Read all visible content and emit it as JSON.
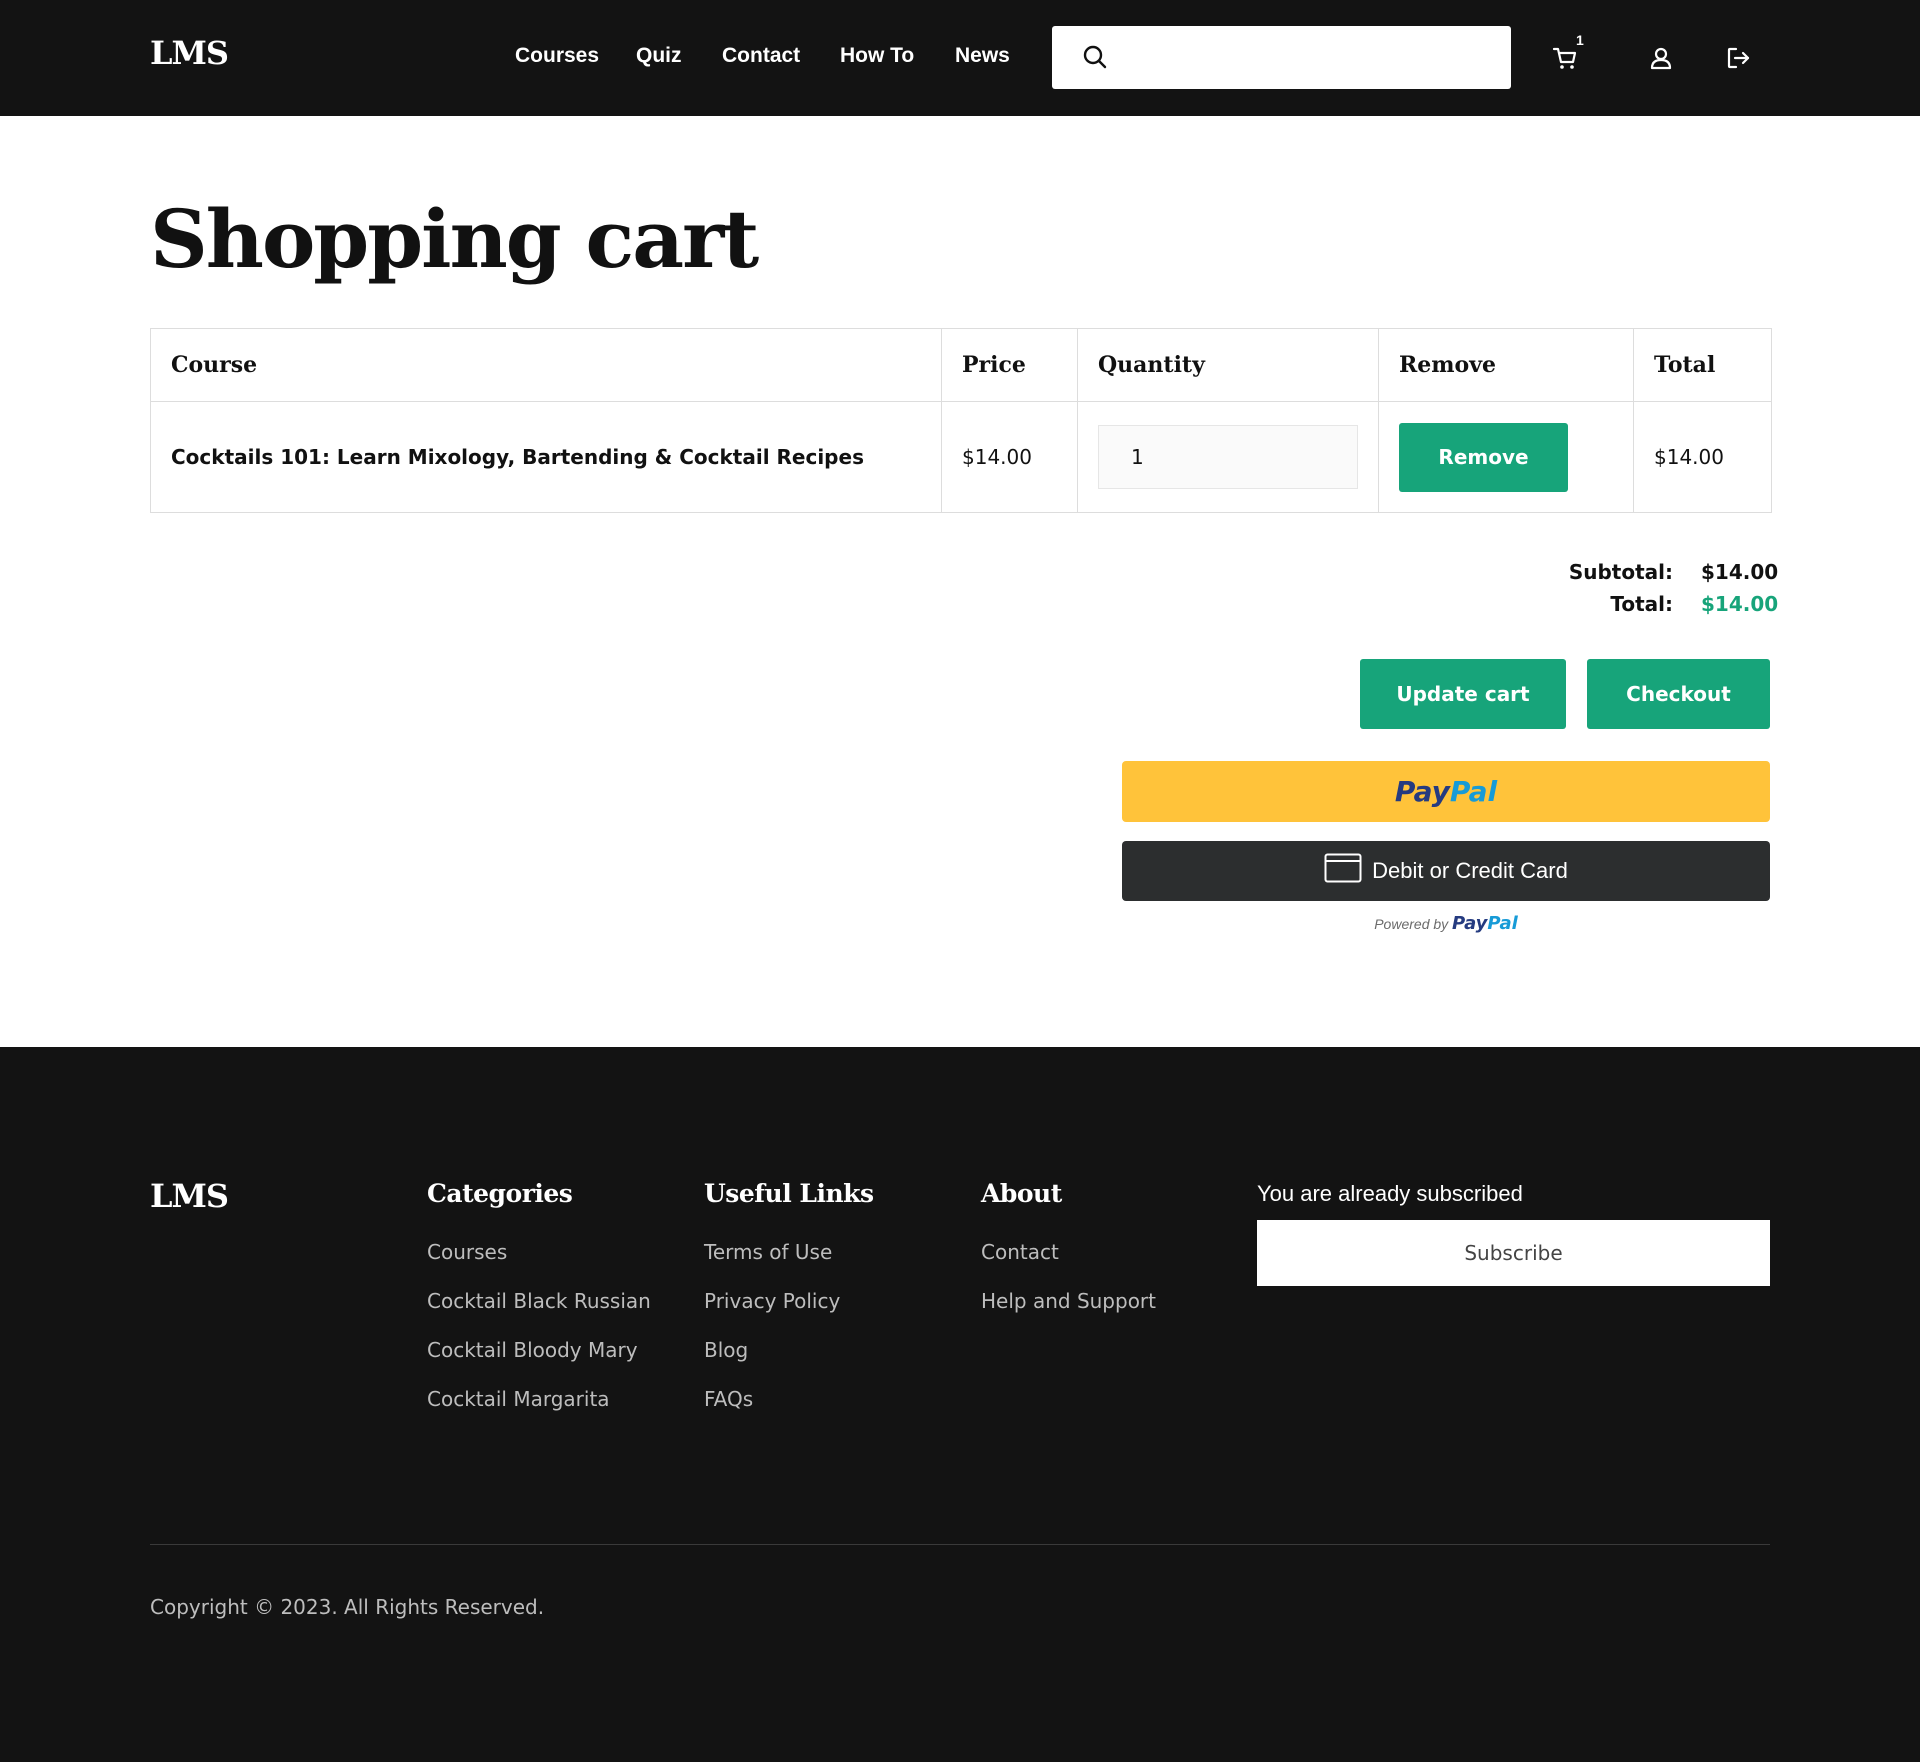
{
  "header": {
    "logo": "LMS",
    "nav": [
      "Courses",
      "Quiz",
      "Contact",
      "How To",
      "News"
    ],
    "search_placeholder": "",
    "cart_count": "1",
    "icons": {
      "search": "search-icon",
      "cart": "cart-icon",
      "account": "user-icon",
      "logout": "logout-icon"
    }
  },
  "main": {
    "title": "Shopping cart",
    "table": {
      "headers": [
        "Course",
        "Price",
        "Quantity",
        "Remove",
        "Total"
      ],
      "rows": [
        {
          "course": "Cocktails 101: Learn Mixology, Bartending & Cocktail Recipes",
          "price": "$14.00",
          "quantity": "1",
          "remove_label": "Remove",
          "total": "$14.00"
        }
      ]
    },
    "totals": {
      "subtotal_label": "Subtotal:",
      "subtotal": "$14.00",
      "total_label": "Total:",
      "total": "$14.00"
    },
    "buttons": {
      "update": "Update cart",
      "checkout": "Checkout"
    },
    "paypal": {
      "brand_a": "Pay",
      "brand_b": "Pal",
      "card_label": "Debit or Credit Card",
      "powered_by": "Powered by"
    }
  },
  "footer": {
    "logo": "LMS",
    "columns": [
      {
        "title": "Categories",
        "links": [
          "Courses",
          "Cocktail Black Russian",
          "Cocktail Bloody Mary",
          "Cocktail Margarita"
        ]
      },
      {
        "title": "Useful Links",
        "links": [
          "Terms of Use",
          "Privacy Policy",
          "Blog",
          "FAQs"
        ]
      },
      {
        "title": "About",
        "links": [
          "Contact",
          "Help and Support"
        ]
      }
    ],
    "subscribed_text": "You are already subscribed",
    "subscribe_label": "Subscribe",
    "copyright": "Copyright © 2023. All Rights Reserved."
  },
  "colors": {
    "accent": "#17a47a",
    "header_bg": "#131313",
    "paypal_yellow": "#ffc33a",
    "card_dark": "#2c2e2f"
  }
}
